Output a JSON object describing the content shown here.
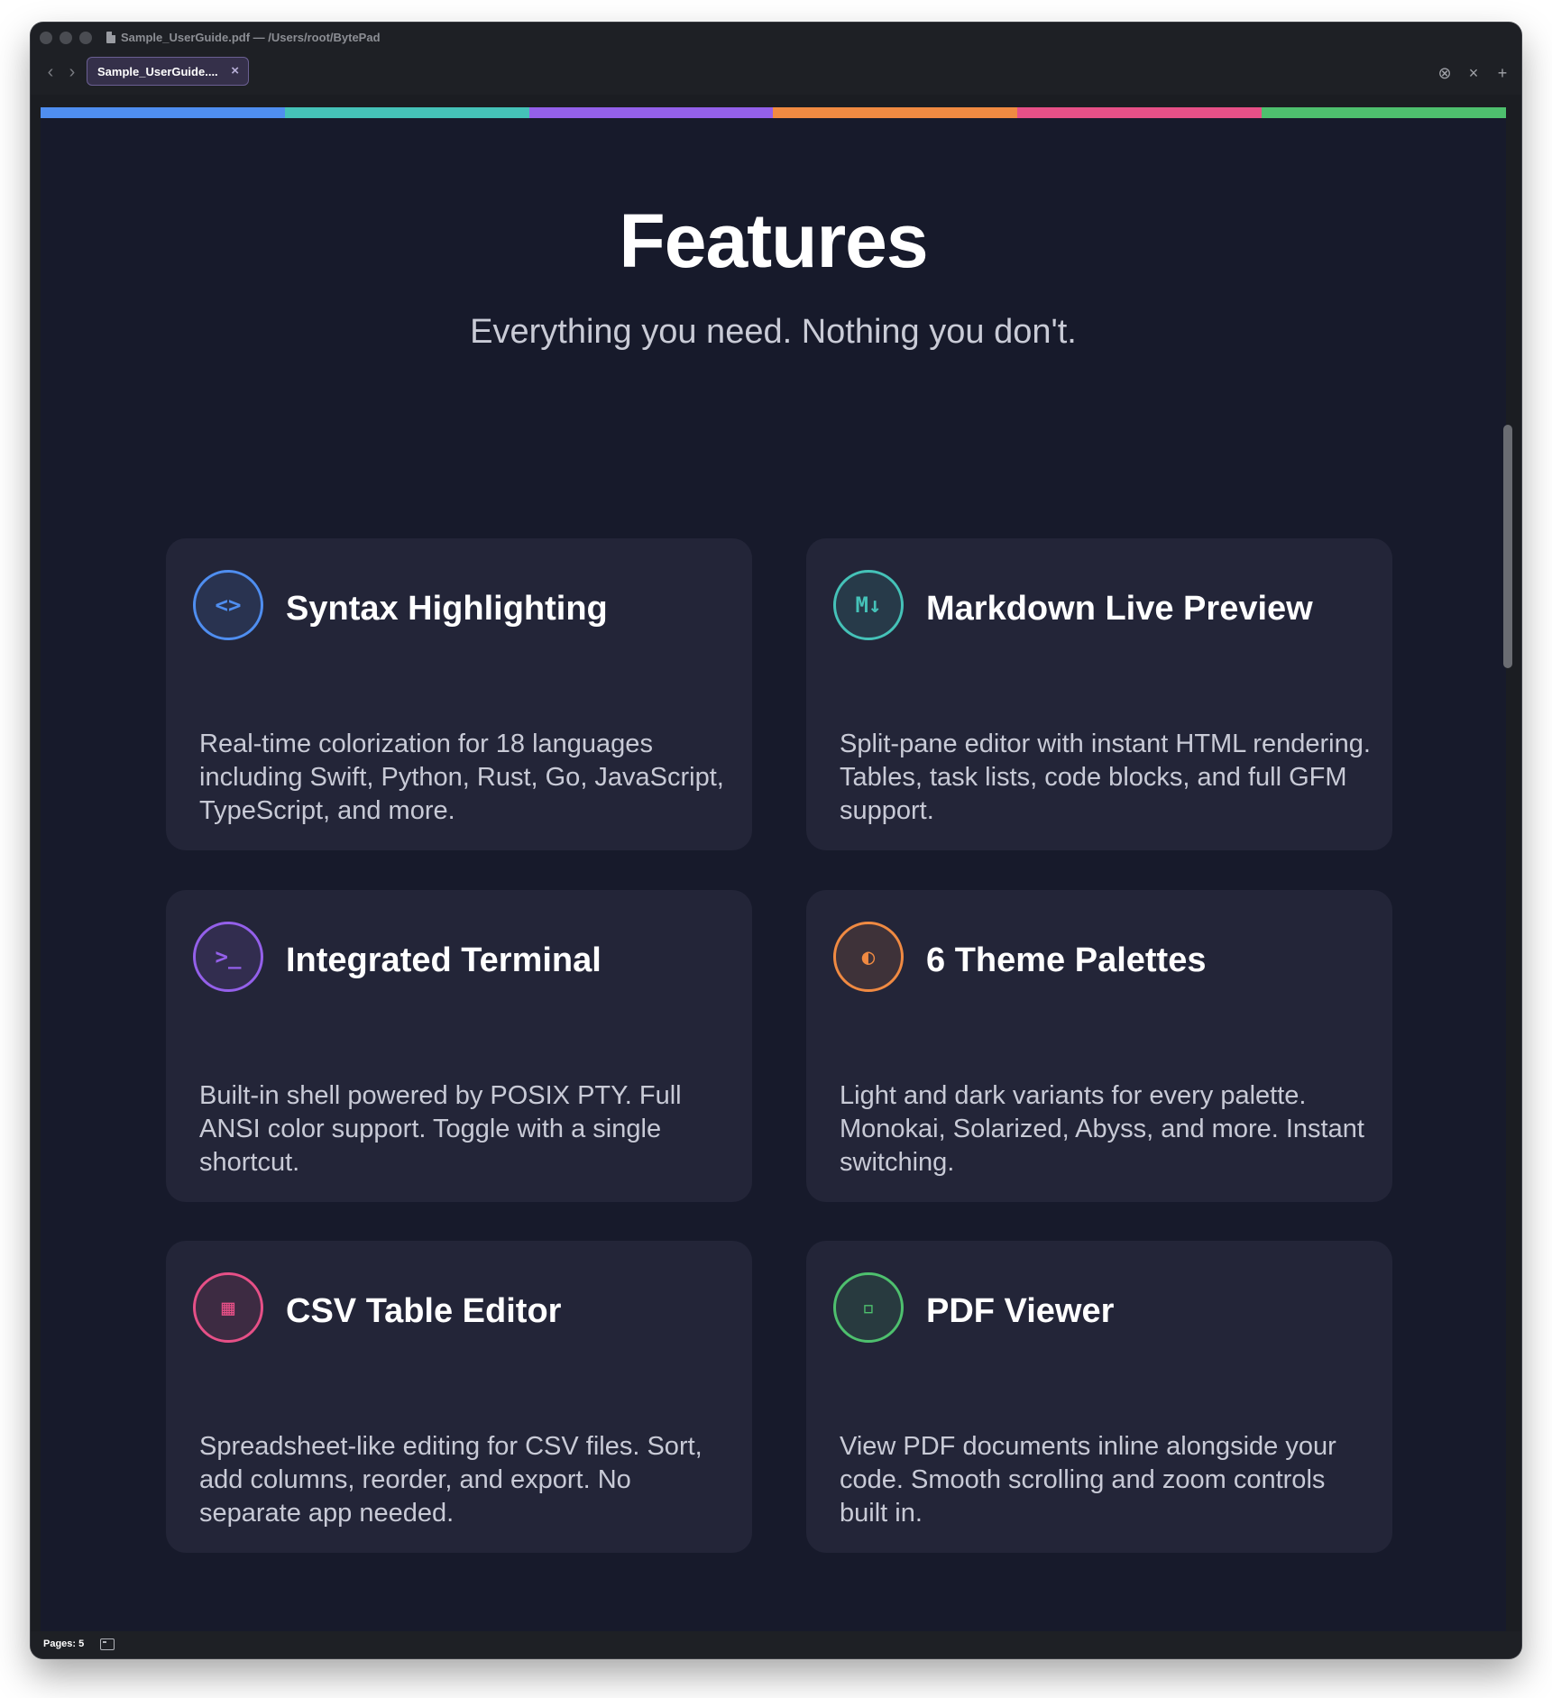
{
  "window": {
    "title": "Sample_UserGuide.pdf — /Users/root/BytePad"
  },
  "tabbar": {
    "back_icon": "‹",
    "forward_icon": "›",
    "active_tab_label": "Sample_UserGuide....",
    "tab_close_icon": "×",
    "stop_icon": "⊗",
    "close_icon": "×",
    "new_tab_icon": "+"
  },
  "colors": {
    "blue": "#4f8ef0",
    "teal": "#45c2b8",
    "purple": "#9460ea",
    "orange": "#f08a42",
    "pink": "#e65087",
    "green": "#4ec06e"
  },
  "page": {
    "heading": "Features",
    "subtitle": "Everything you need. Nothing you don't."
  },
  "cards": [
    {
      "icon_glyph": "<>",
      "icon_name": "code-icon",
      "color": "#4f8ef0",
      "title": "Syntax Highlighting",
      "description": "Real-time colorization for 18 languages including Swift, Python, Rust, Go, JavaScript, TypeScript, and more."
    },
    {
      "icon_glyph": "M↓",
      "icon_name": "markdown-icon",
      "color": "#45c2b8",
      "title": "Markdown Live Preview",
      "description": "Split-pane editor with instant HTML rendering. Tables, task lists, code blocks, and full GFM support."
    },
    {
      "icon_glyph": ">_",
      "icon_name": "terminal-icon",
      "color": "#9460ea",
      "title": "Integrated Terminal",
      "description": "Built-in shell powered by POSIX PTY. Full ANSI color support. Toggle with a single shortcut."
    },
    {
      "icon_glyph": "◐",
      "icon_name": "half-circle-icon",
      "color": "#f08a42",
      "title": "6 Theme Palettes",
      "description": "Light and dark variants for every palette. Monokai, Solarized, Abyss, and more. Instant switching."
    },
    {
      "icon_glyph": "▦",
      "icon_name": "grid-icon",
      "color": "#e65087",
      "title": "CSV Table Editor",
      "description": "Spreadsheet-like editing for CSV files. Sort, add columns, reorder, and export. No separate app needed."
    },
    {
      "icon_glyph": "▫",
      "icon_name": "document-icon",
      "color": "#4ec06e",
      "title": "PDF Viewer",
      "description": "View PDF documents inline alongside your code. Smooth scrolling and zoom controls built in."
    }
  ],
  "statusbar": {
    "pages_label": "Pages: 5"
  }
}
